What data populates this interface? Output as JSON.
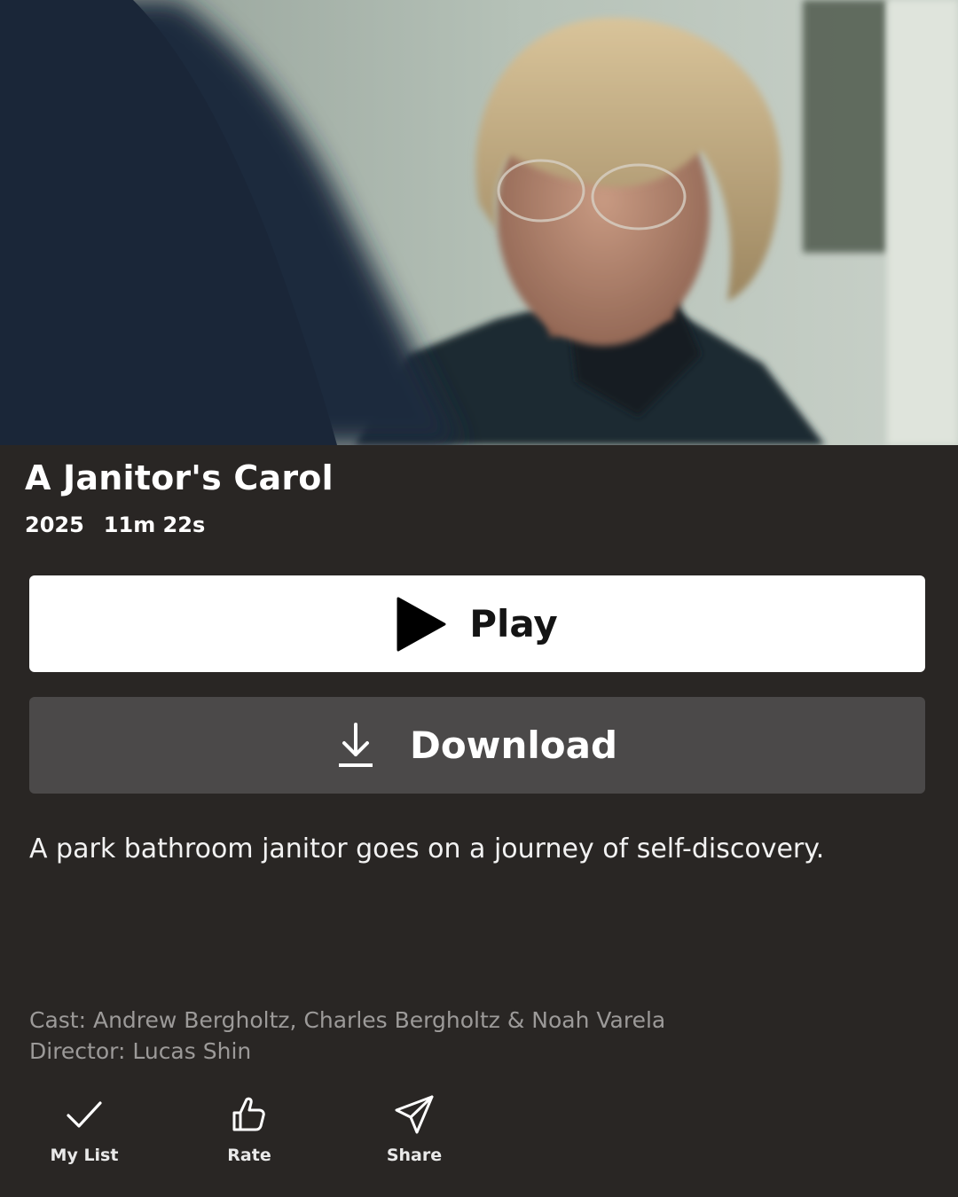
{
  "title": "A Janitor's Carol",
  "meta": {
    "year": "2025",
    "duration": "11m 22s"
  },
  "buttons": {
    "play_label": "Play",
    "download_label": "Download"
  },
  "description": "A park bathroom janitor goes on a journey of self-discovery.",
  "credits": {
    "cast": "Cast: Andrew Bergholtz, Charles Bergholtz & Noah Varela",
    "director": "Director: Lucas Shin"
  },
  "actions": [
    {
      "label": "My List",
      "icon": "check-icon"
    },
    {
      "label": "Rate",
      "icon": "thumbs-up-icon"
    },
    {
      "label": "Share",
      "icon": "send-icon"
    }
  ],
  "colors": {
    "background": "#292624",
    "play_button": "#ffffff",
    "download_button": "#4b4949",
    "credits_text": "#9c9a99"
  }
}
